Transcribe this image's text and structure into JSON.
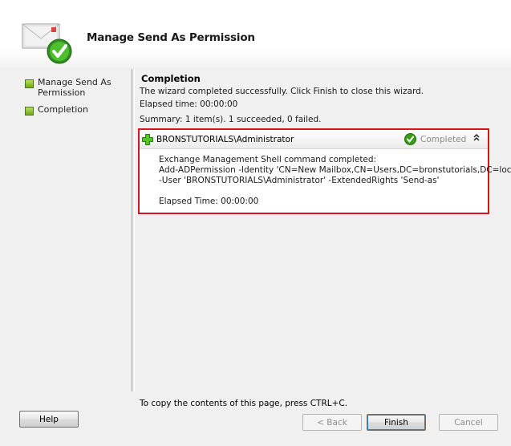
{
  "header": {
    "title": "Manage Send As Permission"
  },
  "steps": [
    {
      "label": "Manage Send As Permission"
    },
    {
      "label": "Completion"
    }
  ],
  "completion": {
    "title": "Completion",
    "message": "The wizard completed successfully. Click Finish to close this wizard.",
    "elapsed": "Elapsed time: 00:00:00",
    "summary": "Summary: 1 item(s). 1 succeeded, 0 failed."
  },
  "result": {
    "user": "BRONSTUTORIALS\\Administrator",
    "status": "Completed",
    "lines": [
      "Exchange Management Shell command completed:",
      "Add-ADPermission -Identity 'CN=New Mailbox,CN=Users,DC=bronstutorials,DC=local'",
      "-User 'BRONSTUTORIALS\\Administrator' -ExtendedRights 'Send-as'",
      "",
      "Elapsed Time: 00:00:00"
    ]
  },
  "footer": {
    "copy_hint": "To copy the contents of this page, press CTRL+C.",
    "help": "Help",
    "back": "< Back",
    "finish": "Finish",
    "cancel": "Cancel"
  },
  "colors": {
    "highlight_border": "#d4151d",
    "success_green": "#3a9a1a"
  }
}
